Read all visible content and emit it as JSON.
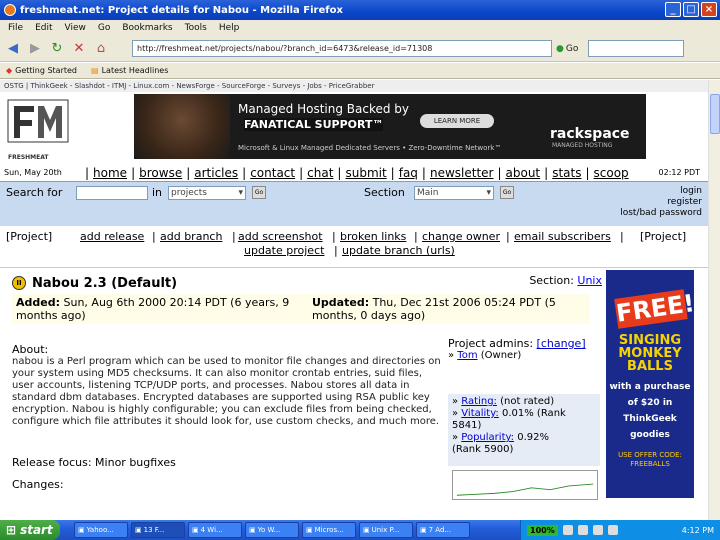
{
  "window": {
    "title": "freshmeat.net: Project details for Nabou - Mozilla Firefox"
  },
  "menu": [
    "File",
    "Edit",
    "View",
    "Go",
    "Bookmarks",
    "Tools",
    "Help"
  ],
  "nav": {
    "url": "http://freshmeat.net/projects/nabou/?branch_id=6473&release_id=71308",
    "go_label": "Go"
  },
  "bookmarks": [
    "Getting Started",
    "Latest Headlines"
  ],
  "ostg": "OSTG | ThinkGeek - Slashdot - ITMJ - Linux.com - NewsForge - SourceForge - Surveys - Jobs - PriceGrabber",
  "ad": {
    "line1": "Managed Hosting Backed by",
    "line2": "FANATICAL SUPPORT™",
    "learn": "LEARN MORE",
    "brand": "rackspace",
    "brand_sub": "MANAGED HOSTING",
    "line3": "Microsoft & Linux Managed Dedicated Servers • Zero-Downtime Network™"
  },
  "logo_text": "FRESHMEAT",
  "sitenav": {
    "date": "Sun, May 20th",
    "links": [
      "home",
      "browse",
      "articles",
      "contact",
      "chat",
      "submit",
      "faq",
      "newsletter",
      "about",
      "stats",
      "scoop"
    ],
    "time": "02:12 PDT"
  },
  "search": {
    "label": "Search for",
    "in": "in",
    "scope": "projects",
    "section_label": "Section",
    "section_value": "Main",
    "go": "Go",
    "login": "login",
    "register": "register",
    "lost": "lost/bad password"
  },
  "projlinks": {
    "project": "[Project]",
    "project_r": "[Project]",
    "links": [
      "add release",
      "add branch",
      "add screenshot",
      "broken links",
      "change owner",
      "email subscribers"
    ],
    "links2": [
      "update project",
      "update branch (urls)"
    ]
  },
  "project": {
    "title": "Nabou 2.3 (Default)",
    "section_label": "Section:",
    "section_value": "Unix",
    "added_label": "Added:",
    "added": "Sun, Aug 6th 2000 20:14 PDT (6 years, 9 months ago)",
    "updated_label": "Updated:",
    "updated": "Thu, Dec 21st 2006 05:24 PDT (5 months, 0 days ago)"
  },
  "about": {
    "heading": "About:",
    "text": "nabou is a Perl program which can be used to monitor file changes and directories on your system using MD5 checksums. It can also monitor crontab entries, suid files, user accounts, listening TCP/UDP ports, and processes. Nabou stores all data in standard dbm databases. Encrypted databases are supported using RSA public key encryption. Nabou is highly configurable; you can exclude files from being checked, configure which file attributes it should look for, use custom checks, and much more."
  },
  "release_focus": {
    "label": "Release focus:",
    "value": "Minor bugfixes"
  },
  "changes_label": "Changes:",
  "admins": {
    "heading": "Project admins:",
    "change": "[change]",
    "admin": "Tom",
    "role": "(Owner)"
  },
  "rating": {
    "rating_label": "Rating:",
    "rating": "(not rated)",
    "vitality_label": "Vitality:",
    "vitality": "0.01% (Rank 5841)",
    "popularity_label": "Popularity:",
    "popularity": "0.92%",
    "popularity_rank": "(Rank 5900)"
  },
  "geek": {
    "free": "FREE!",
    "sing": "SINGING MONKEY BALLS",
    "small": "with a purchase of $20 in ThinkGeek goodies",
    "code": "USE OFFER CODE: FREEBALLS"
  },
  "taskbar": {
    "start": "start",
    "tasks": [
      "Yahoo...",
      "13 F...",
      "4 Wi...",
      "Yo W...",
      "Micros...",
      "Unix P...",
      "7 Ad..."
    ],
    "battery": "100%",
    "clock": "4:12 PM"
  }
}
